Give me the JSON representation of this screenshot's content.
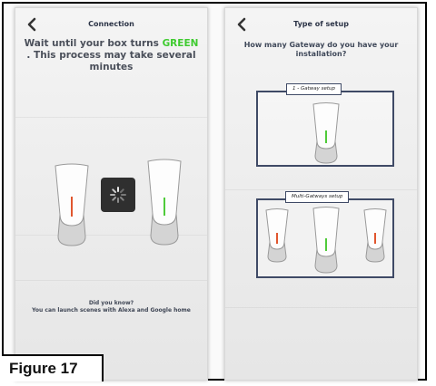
{
  "left_screen": {
    "title": "Connection",
    "message_part1": "Wait until your box turns ",
    "message_highlight": "GREEN",
    "message_part2": " . This process may take several minutes",
    "did_you_know_title": "Did you know?",
    "did_you_know_text": "You can launch scenes with Alexa and Google home"
  },
  "right_screen": {
    "title": "Type of setup",
    "question": "How many Gateway do you have your installation?",
    "option1_label": "1 - Gatway setup",
    "option2_label": "Multi-Gatways setup"
  },
  "caption": "Figure 17",
  "colors": {
    "highlight_green": "#3ecb2f",
    "led_orange": "#e0562e",
    "led_green": "#4fcb3a",
    "border_navy": "#3f4a66"
  },
  "icons": [
    "back-chevron-icon",
    "loading-spinner-icon"
  ]
}
